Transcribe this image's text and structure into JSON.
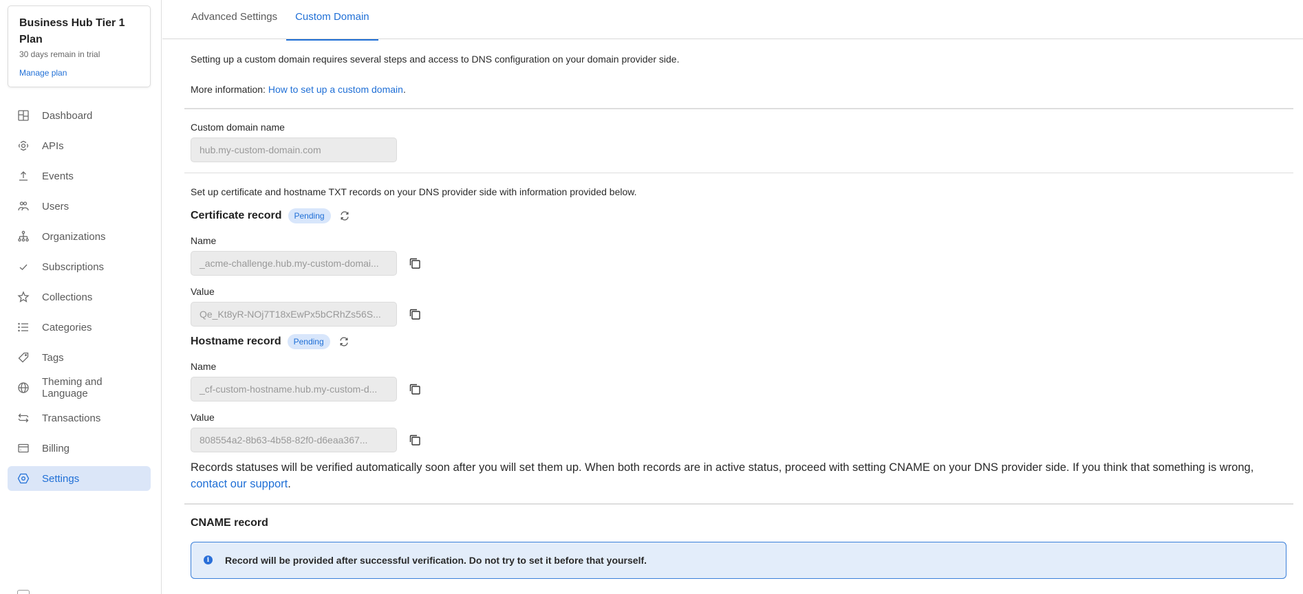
{
  "sidebar": {
    "plan": {
      "title": "Business Hub Tier 1 Plan",
      "subtitle": "30 days remain in trial",
      "link": "Manage plan"
    },
    "items": [
      {
        "label": "Dashboard",
        "icon": "dashboard-icon"
      },
      {
        "label": "APIs",
        "icon": "apis-icon"
      },
      {
        "label": "Events",
        "icon": "upload-icon"
      },
      {
        "label": "Users",
        "icon": "users-icon"
      },
      {
        "label": "Organizations",
        "icon": "hierarchy-icon"
      },
      {
        "label": "Subscriptions",
        "icon": "check-icon"
      },
      {
        "label": "Collections",
        "icon": "star-icon"
      },
      {
        "label": "Categories",
        "icon": "list-icon"
      },
      {
        "label": "Tags",
        "icon": "tag-icon"
      },
      {
        "label": "Theming and Language",
        "icon": "globe-icon"
      },
      {
        "label": "Transactions",
        "icon": "transfer-icon"
      },
      {
        "label": "Billing",
        "icon": "credit-card-icon"
      },
      {
        "label": "Settings",
        "icon": "settings-icon",
        "active": true
      }
    ]
  },
  "tabs": [
    {
      "label": "Advanced Settings",
      "active": false
    },
    {
      "label": "Custom Domain",
      "active": true
    }
  ],
  "intro": {
    "text": "Setting up a custom domain requires several steps and access to DNS configuration on your domain provider side.",
    "more_prefix": "More information: ",
    "more_link": "How to set up a custom domain",
    "more_suffix": "."
  },
  "domain_field": {
    "label": "Custom domain name",
    "placeholder": "hub.my-custom-domain.com"
  },
  "records_intro": "Set up certificate and hostname TXT records on your DNS provider side with information provided below.",
  "certificate_record": {
    "title": "Certificate record",
    "status": "Pending",
    "name_label": "Name",
    "name_value": "_acme-challenge.hub.my-custom-domai...",
    "value_label": "Value",
    "value_value": "Qe_Kt8yR-NOj7T18xEwPx5bCRhZs56S..."
  },
  "hostname_record": {
    "title": "Hostname record",
    "status": "Pending",
    "name_label": "Name",
    "name_value": "_cf-custom-hostname.hub.my-custom-d...",
    "value_label": "Value",
    "value_value": "808554a2-8b63-4b58-82f0-d6eaa367..."
  },
  "verification_note": {
    "text": "Records statuses will be verified automatically soon after you will set them up. When both records are in active status, proceed with setting CNAME on your DNS provider side. If you think that something is wrong, ",
    "link": "contact our support",
    "suffix": "."
  },
  "cname": {
    "title": "CNAME record",
    "info": "Record will be provided after successful verification. Do not try to set it before that yourself."
  },
  "colors": {
    "accent": "#1f6fd6",
    "active_bg": "#dbe6f8",
    "badge_bg": "#d8e6fb",
    "info_bg": "#e3edfa",
    "info_border": "#3a7fd9"
  }
}
